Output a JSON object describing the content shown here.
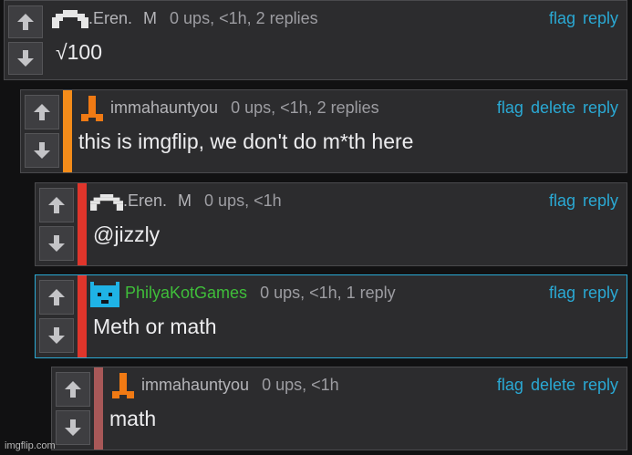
{
  "comments": [
    {
      "username": ".Eren.",
      "badge": "M",
      "stats": "0 ups, <1h, 2 replies",
      "actions": [
        "flag",
        "reply"
      ],
      "text": "√100"
    },
    {
      "username": "immahauntyou",
      "badge": "",
      "stats": "0 ups, <1h, 2 replies",
      "actions": [
        "flag",
        "delete",
        "reply"
      ],
      "text": "this is imgflip, we don't do m*th here"
    },
    {
      "username": ".Eren.",
      "badge": "M",
      "stats": "0 ups, <1h",
      "actions": [
        "flag",
        "reply"
      ],
      "text": "@jizzly"
    },
    {
      "username": "PhilyaKotGames",
      "badge": "",
      "stats": "0 ups, <1h, 1 reply",
      "actions": [
        "flag",
        "reply"
      ],
      "text": "Meth or math"
    },
    {
      "username": "immahauntyou",
      "badge": "",
      "stats": "0 ups, <1h",
      "actions": [
        "flag",
        "delete",
        "reply"
      ],
      "text": "math"
    }
  ],
  "colors": {
    "bar_orange": "#f48c1a",
    "bar_red": "#e0352b",
    "bar_muted_red": "#a85858",
    "link_blue": "#2aa9d4",
    "username_green": "#3fbe3a",
    "highlight_border": "#2aa9d4"
  },
  "icons": {
    "upvote": "arrow-up-icon",
    "downvote": "arrow-down-icon",
    "avatar_eren": "pixel-invader-icon",
    "avatar_immahauntyou": "pixel-gallows-icon",
    "avatar_philyakot": "pixel-cat-icon"
  },
  "watermark": "imgflip.com"
}
